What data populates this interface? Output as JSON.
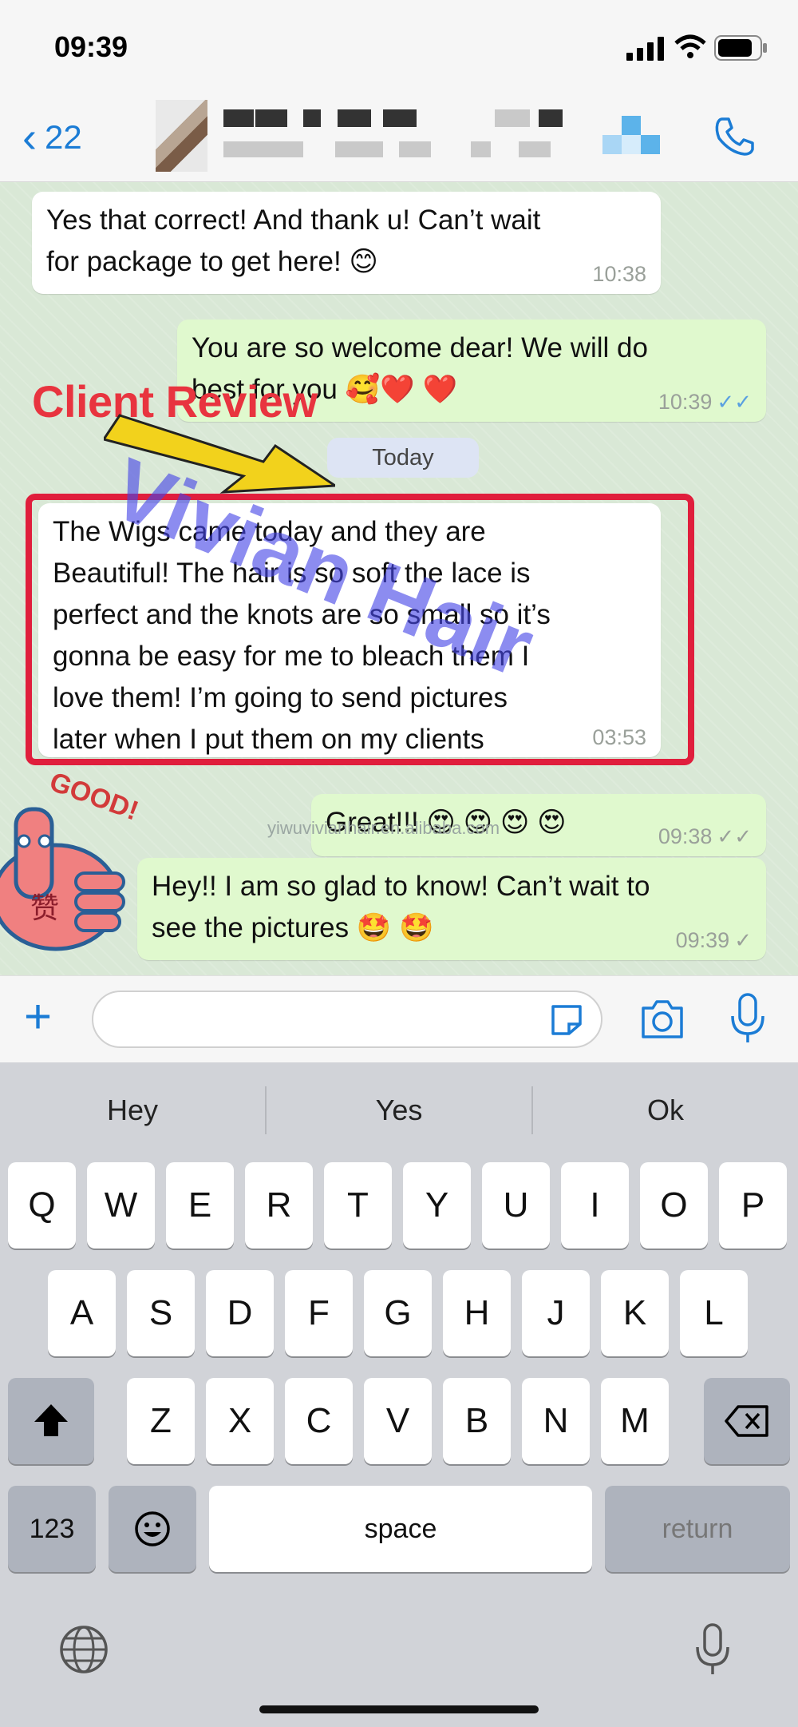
{
  "status_bar": {
    "time": "09:39"
  },
  "nav": {
    "back_count": "22"
  },
  "overlay": {
    "review_label": "Client Review",
    "watermark": "Vivian Hair",
    "site": "yiwuvivianhair.en.alibaba.com"
  },
  "chat": {
    "day_separator": "Today",
    "messages": [
      {
        "direction": "in",
        "text": "Yes that correct! And thank u! Can’t wait\nfor package to get here! 😊",
        "time": "10:38"
      },
      {
        "direction": "out",
        "text": "You are so welcome dear! We will do\nbest for you 🥰❤️ ❤️",
        "time": "10:39",
        "status": "read"
      },
      {
        "direction": "in",
        "text": "The Wigs came today and they are\nBeautiful! The hair is so soft the lace is\nperfect and the knots are so small so it’s\ngonna be easy for me to bleach them I\nlove them! I’m going to send pictures\nlater when I put them on my clients",
        "time": "03:53"
      },
      {
        "direction": "out",
        "text": "Great!!! 😍 😍 😍 😍",
        "time": "09:38",
        "status": "delivered"
      },
      {
        "direction": "out",
        "text": "Hey!! I am so glad to know! Can’t wait to\nsee the pictures 🤩 🤩",
        "time": "09:39",
        "status": "sent"
      }
    ]
  },
  "sticker": {
    "text": "GOOD!",
    "char": "赞"
  },
  "keyboard": {
    "suggestions": [
      "Hey",
      "Yes",
      "Ok"
    ],
    "row1": [
      "Q",
      "W",
      "E",
      "R",
      "T",
      "Y",
      "U",
      "I",
      "O",
      "P"
    ],
    "row2": [
      "A",
      "S",
      "D",
      "F",
      "G",
      "H",
      "J",
      "K",
      "L"
    ],
    "row3": [
      "Z",
      "X",
      "C",
      "V",
      "B",
      "N",
      "M"
    ],
    "numbers_key": "123",
    "space_key": "space",
    "return_key": "return"
  },
  "colors": {
    "accent": "#1b7cd5",
    "outgoing": "#e0f9ce",
    "incoming": "#ffffff",
    "highlight": "#e01e3c",
    "read_ticks": "#5aa0e0"
  }
}
